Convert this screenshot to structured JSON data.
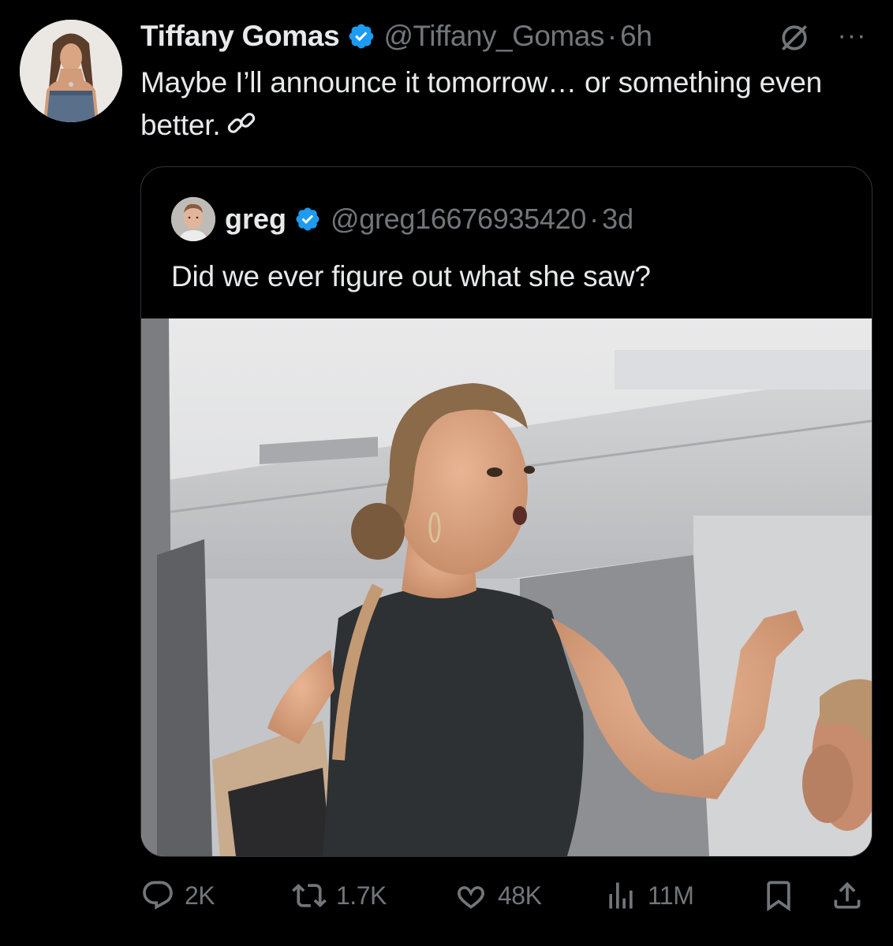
{
  "tweet": {
    "author": {
      "display_name": "Tiffany Gomas",
      "handle": "@Tiffany_Gomas",
      "verified": true,
      "avatar_icon": "profile-photo"
    },
    "separator": "·",
    "time": "6h",
    "grok_icon": "grok-icon",
    "more_icon": "more-icon",
    "text": "Maybe I’ll announce it tomorrow… or something even better.",
    "text_trailing_icon": "link-icon"
  },
  "quote": {
    "author": {
      "display_name": "greg",
      "handle": "@greg16676935420",
      "verified": true,
      "avatar_icon": "profile-photo"
    },
    "separator": "·",
    "time": "3d",
    "text": "Did we ever figure out what she saw?",
    "media": {
      "type": "image",
      "description_icon": "airplane-cabin-photo"
    }
  },
  "actions": {
    "replies": "2K",
    "reposts": "1.7K",
    "likes": "48K",
    "views": "11M"
  },
  "colors": {
    "background": "#000000",
    "text_primary": "#e7e9ea",
    "text_secondary": "#71767b",
    "verified_blue": "#1d9bf0",
    "border": "#2f3336"
  }
}
